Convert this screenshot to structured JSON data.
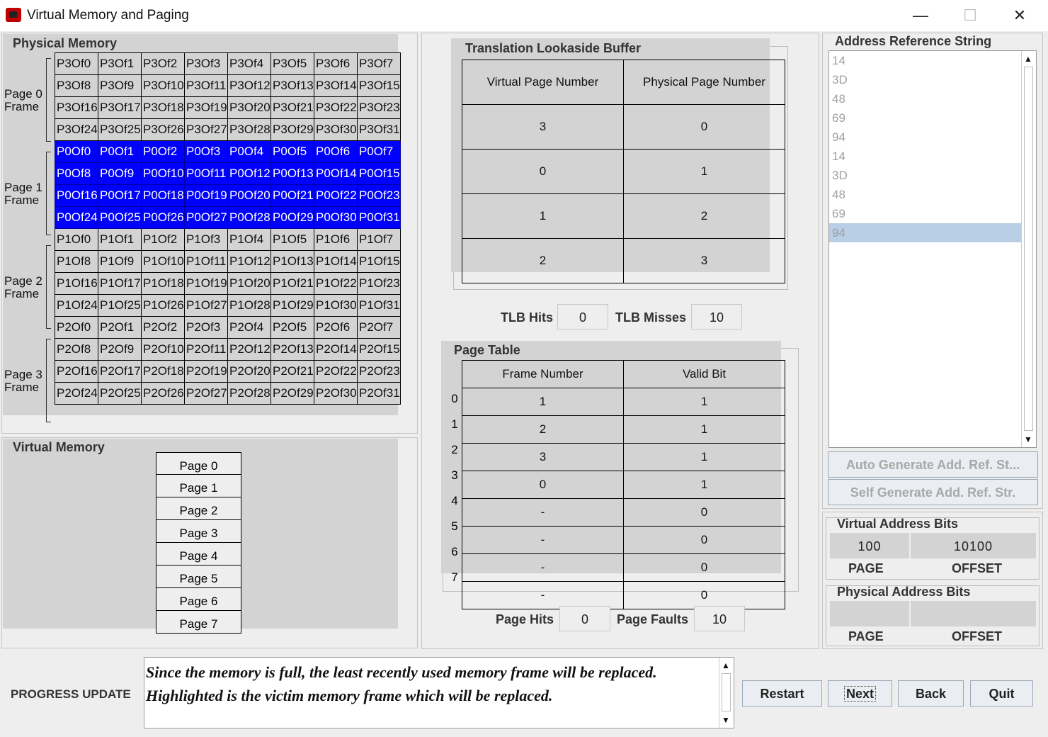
{
  "window": {
    "title": "Virtual Memory and Paging",
    "minimize": "—",
    "maximize": "☐",
    "close": "✕"
  },
  "physical_memory": {
    "title": "Physical Memory",
    "frames": [
      {
        "label_line1": "Page 0",
        "label_line2": "Frame"
      },
      {
        "label_line1": "Page 1",
        "label_line2": "Frame"
      },
      {
        "label_line1": "Page 2",
        "label_line2": "Frame"
      },
      {
        "label_line1": "Page 3",
        "label_line2": "Frame"
      }
    ],
    "rows": [
      [
        "P3Of0",
        "P3Of1",
        "P3Of2",
        "P3Of3",
        "P3Of4",
        "P3Of5",
        "P3Of6",
        "P3Of7"
      ],
      [
        "P3Of8",
        "P3Of9",
        "P3Of10",
        "P3Of11",
        "P3Of12",
        "P3Of13",
        "P3Of14",
        "P3Of15"
      ],
      [
        "P3Of16",
        "P3Of17",
        "P3Of18",
        "P3Of19",
        "P3Of20",
        "P3Of21",
        "P3Of22",
        "P3Of23"
      ],
      [
        "P3Of24",
        "P3Of25",
        "P3Of26",
        "P3Of27",
        "P3Of28",
        "P3Of29",
        "P3Of30",
        "P3Of31"
      ],
      [
        "P0Of0",
        "P0Of1",
        "P0Of2",
        "P0Of3",
        "P0Of4",
        "P0Of5",
        "P0Of6",
        "P0Of7"
      ],
      [
        "P0Of8",
        "P0Of9",
        "P0Of10",
        "P0Of11",
        "P0Of12",
        "P0Of13",
        "P0Of14",
        "P0Of15"
      ],
      [
        "P0Of16",
        "P0Of17",
        "P0Of18",
        "P0Of19",
        "P0Of20",
        "P0Of21",
        "P0Of22",
        "P0Of23"
      ],
      [
        "P0Of24",
        "P0Of25",
        "P0Of26",
        "P0Of27",
        "P0Of28",
        "P0Of29",
        "P0Of30",
        "P0Of31"
      ],
      [
        "P1Of0",
        "P1Of1",
        "P1Of2",
        "P1Of3",
        "P1Of4",
        "P1Of5",
        "P1Of6",
        "P1Of7"
      ],
      [
        "P1Of8",
        "P1Of9",
        "P1Of10",
        "P1Of11",
        "P1Of12",
        "P1Of13",
        "P1Of14",
        "P1Of15"
      ],
      [
        "P1Of16",
        "P1Of17",
        "P1Of18",
        "P1Of19",
        "P1Of20",
        "P1Of21",
        "P1Of22",
        "P1Of23"
      ],
      [
        "P1Of24",
        "P1Of25",
        "P1Of26",
        "P1Of27",
        "P1Of28",
        "P1Of29",
        "P1Of30",
        "P1Of31"
      ],
      [
        "P2Of0",
        "P2Of1",
        "P2Of2",
        "P2Of3",
        "P2Of4",
        "P2Of5",
        "P2Of6",
        "P2Of7"
      ],
      [
        "P2Of8",
        "P2Of9",
        "P2Of10",
        "P2Of11",
        "P2Of12",
        "P2Of13",
        "P2Of14",
        "P2Of15"
      ],
      [
        "P2Of16",
        "P2Of17",
        "P2Of18",
        "P2Of19",
        "P2Of20",
        "P2Of21",
        "P2Of22",
        "P2Of23"
      ],
      [
        "P2Of24",
        "P2Of25",
        "P2Of26",
        "P2Of27",
        "P2Of28",
        "P2Of29",
        "P2Of30",
        "P2Of31"
      ]
    ],
    "highlighted_frame": 1
  },
  "virtual_memory": {
    "title": "Virtual Memory",
    "pages": [
      "Page 0",
      "Page 1",
      "Page 2",
      "Page 3",
      "Page 4",
      "Page 5",
      "Page 6",
      "Page 7"
    ]
  },
  "tlb": {
    "title": "Translation Lookaside Buffer",
    "headers": [
      "Virtual Page Number",
      "Physical Page Number"
    ],
    "rows": [
      [
        "3",
        "0"
      ],
      [
        "0",
        "1"
      ],
      [
        "1",
        "2"
      ],
      [
        "2",
        "3"
      ]
    ],
    "hits_label": "TLB Hits",
    "hits": "0",
    "misses_label": "TLB Misses",
    "misses": "10"
  },
  "page_table": {
    "title": "Page Table",
    "headers": [
      "Frame Number",
      "Valid Bit"
    ],
    "indices": [
      "0",
      "1",
      "2",
      "3",
      "4",
      "5",
      "6",
      "7"
    ],
    "rows": [
      [
        "1",
        "1"
      ],
      [
        "2",
        "1"
      ],
      [
        "3",
        "1"
      ],
      [
        "0",
        "1"
      ],
      [
        "-",
        "0"
      ],
      [
        "-",
        "0"
      ],
      [
        "-",
        "0"
      ],
      [
        "-",
        "0"
      ]
    ],
    "hits_label": "Page Hits",
    "hits": "0",
    "faults_label": "Page Faults",
    "faults": "10"
  },
  "reference_string": {
    "title": "Address Reference String",
    "items": [
      "14",
      "3D",
      "48",
      "69",
      "94",
      "14",
      "3D",
      "48",
      "69",
      "94"
    ],
    "selected_index": 9,
    "auto_button": "Auto Generate Add. Ref. St...",
    "self_button": "Self Generate Add. Ref. Str."
  },
  "virtual_address": {
    "title": "Virtual Address Bits",
    "page": "100",
    "offset": "10100",
    "page_label": "PAGE",
    "offset_label": "OFFSET"
  },
  "physical_address": {
    "title": "Physical Address Bits",
    "page": "",
    "offset": "",
    "page_label": "PAGE",
    "offset_label": "OFFSET"
  },
  "progress": {
    "label": "PROGRESS UPDATE",
    "line1": "Since the memory is full, the least recently used memory frame will be replaced.",
    "line2": "Highlighted is the victim memory frame which will be replaced."
  },
  "buttons": {
    "restart": "Restart",
    "next": "Next",
    "back": "Back",
    "quit": "Quit"
  }
}
